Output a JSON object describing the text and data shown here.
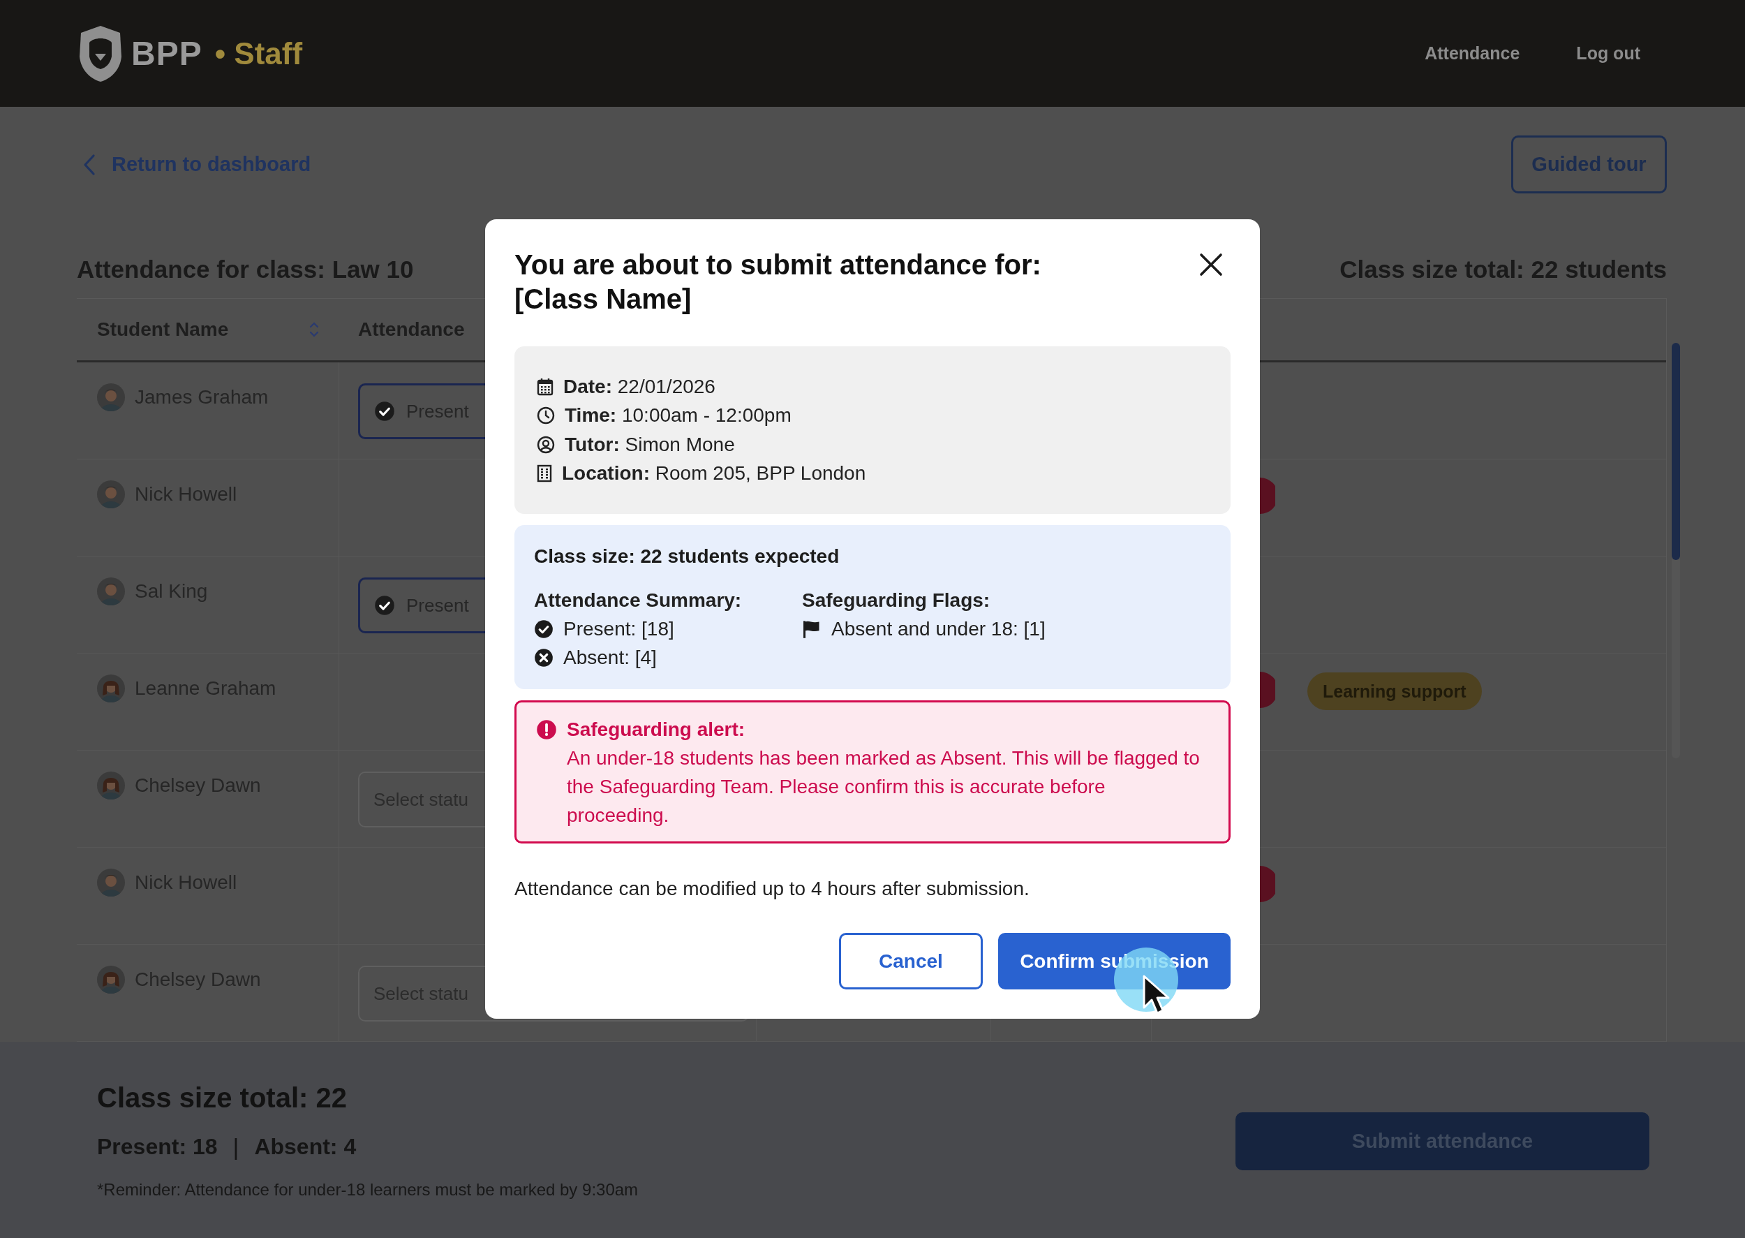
{
  "header": {
    "brand": "BPP",
    "product": "• Staff",
    "nav": [
      {
        "label": "Attendance"
      },
      {
        "label": "Log out"
      }
    ]
  },
  "toolbar": {
    "back_link": "Return to dashboard",
    "guided_tour": "Guided tour"
  },
  "title": "Attendance for class: Law 10",
  "class_total": "Class size total: 22 students",
  "table": {
    "columns": [
      {
        "label": "Student Name",
        "sortable": true
      },
      {
        "label": "Attendance",
        "sortable": false
      }
    ],
    "rows": [
      {
        "name": "James Graham",
        "kind": "shorthair",
        "attendance": {
          "kind": "chosen",
          "text": "Present"
        },
        "flag": false
      },
      {
        "name": "Nick Howell",
        "kind": "shorthair",
        "flag": true
      },
      {
        "name": "Sal King",
        "kind": "shorthair",
        "attendance": {
          "kind": "chosen",
          "text": "Present"
        },
        "flag": false
      },
      {
        "name": "Leanne Graham",
        "kind": "longhair",
        "flag": true,
        "tags": [
          "Learning support"
        ]
      },
      {
        "name": "Chelsey Dawn",
        "kind": "longhair",
        "attendance": {
          "kind": "empty",
          "text": "Select statu"
        },
        "flag": false
      },
      {
        "name": "Nick Howell",
        "kind": "shorthair",
        "flag": true
      },
      {
        "name": "Chelsey Dawn",
        "kind": "longhair",
        "attendance": {
          "kind": "empty",
          "text": "Select statu"
        },
        "flag": false
      }
    ]
  },
  "footer": {
    "total": "Class size total: 22",
    "present": "Present: 18",
    "separator": "|",
    "absent": "Absent: 4",
    "reminder": "*Reminder: Attendance for under-18 learners must be marked by 9:30am",
    "submit": "Submit attendance"
  },
  "modal": {
    "title": "You are about to submit attendance for: [Class Name]",
    "details": [
      {
        "kind": "calendar",
        "text": "**Date:** 22/01/2026"
      },
      {
        "kind": "clock",
        "text": "**Time:** 10:00am - 12:00pm"
      },
      {
        "kind": "person",
        "text": "**Tutor:** Simon Mone"
      },
      {
        "kind": "building",
        "text": "**Location:** Room 205, BPP London"
      }
    ],
    "summary": {
      "heading": "Class size: 22 students expected",
      "columns": [
        {
          "heading": "Attendance Summary:",
          "items": [
            {
              "kind": "check",
              "text": "Present: [18]"
            },
            {
              "kind": "cross",
              "text": "Absent: [4]"
            }
          ]
        },
        {
          "heading": "Safeguarding Flags:",
          "items": [
            {
              "kind": "flag",
              "text": "Absent and under 18: [1]"
            }
          ]
        }
      ]
    },
    "alert": {
      "title": "Safeguarding alert:",
      "message": "An under-18 students has been marked as Absent. This will be flagged to the Safeguarding Team. Please confirm this is accurate before proceeding."
    },
    "note": "Attendance can be modified up to 4 hours after submission.",
    "buttons": [
      {
        "label": "Cancel",
        "kind": "secondary"
      },
      {
        "label": "Confirm submission",
        "kind": "primary"
      }
    ]
  }
}
